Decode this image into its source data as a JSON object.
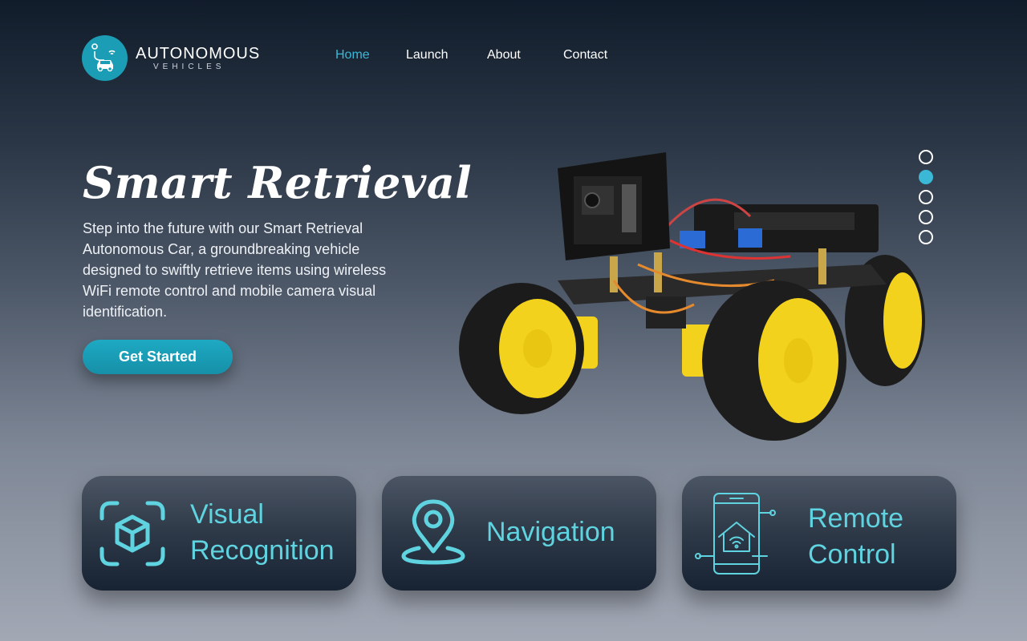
{
  "brand": {
    "title": "AUTONOMOUS",
    "subtitle": "VEHICLES",
    "icon": "car-wifi-icon",
    "accent": "#1b9db5"
  },
  "nav": {
    "items": [
      {
        "label": "Home",
        "active": true
      },
      {
        "label": "Launch",
        "active": false
      },
      {
        "label": "About",
        "active": false
      },
      {
        "label": "Contact",
        "active": false
      }
    ],
    "active_color": "#3bb8d6"
  },
  "hero": {
    "title": "Smart Retrieval",
    "description": "Step into the future with our Smart Retrieval Autonomous Car, a groundbreaking vehicle designed to swiftly retrieve items using wireless WiFi remote control and mobile camera visual identification.",
    "cta_label": "Get Started"
  },
  "slider": {
    "count": 5,
    "active_index": 1
  },
  "features": [
    {
      "line1": "Visual",
      "line2": "Recognition",
      "icon": "cube-scan-icon"
    },
    {
      "line1": "Navigation",
      "line2": "",
      "icon": "map-pin-icon"
    },
    {
      "line1": "Remote",
      "line2": "Control",
      "icon": "smartphone-home-icon"
    }
  ],
  "colors": {
    "feature_text": "#5fd3df",
    "button": "#1ea9c3"
  }
}
